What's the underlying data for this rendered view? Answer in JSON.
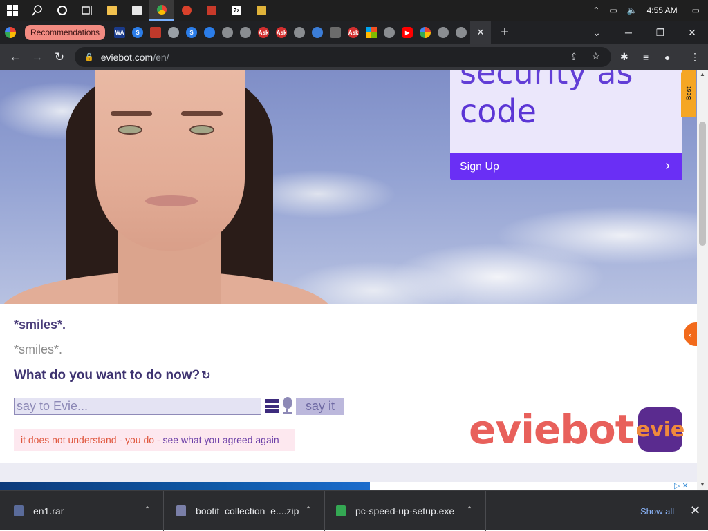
{
  "taskbar": {
    "clock": "4:55 AM",
    "icons": [
      "windows-start-icon",
      "search-icon",
      "cortana-icon",
      "task-view-icon",
      "file-explorer-icon",
      "store-icon",
      "chrome-icon",
      "app-icon",
      "app-icon",
      "7zip-icon",
      "app-icon"
    ]
  },
  "browser": {
    "recommendations_tab": "Recommendations",
    "url_host": "eviebot.com",
    "url_path": "/en/",
    "tab_close": "✕",
    "new_tab": "+"
  },
  "ad": {
    "headline_line1": "security  as",
    "headline_line2": "code",
    "cta": "Sign Up",
    "side_tab": "Best"
  },
  "chat": {
    "evie_says": "*smiles*.",
    "user_said": "*smiles*.",
    "question": "What do you want to do now?",
    "input_placeholder": "say to Evie...",
    "say_button": "say it",
    "notice_part1": "it does not understand",
    "notice_sep1": " - ",
    "notice_part2": "you do",
    "notice_sep2": " - ",
    "notice_part3": "see what you agreed again"
  },
  "logo": {
    "text": "eviebot",
    "icon_text": "evie"
  },
  "downloads": {
    "items": [
      "en1.rar",
      "bootit_collection_e....zip",
      "pc-speed-up-setup.exe"
    ],
    "show_all": "Show all"
  },
  "colors": {
    "chrome_dark": "#202124",
    "ad_purple": "#6a2ff5",
    "evie_text": "#3d3270",
    "accent_orange": "#f26a1b"
  }
}
